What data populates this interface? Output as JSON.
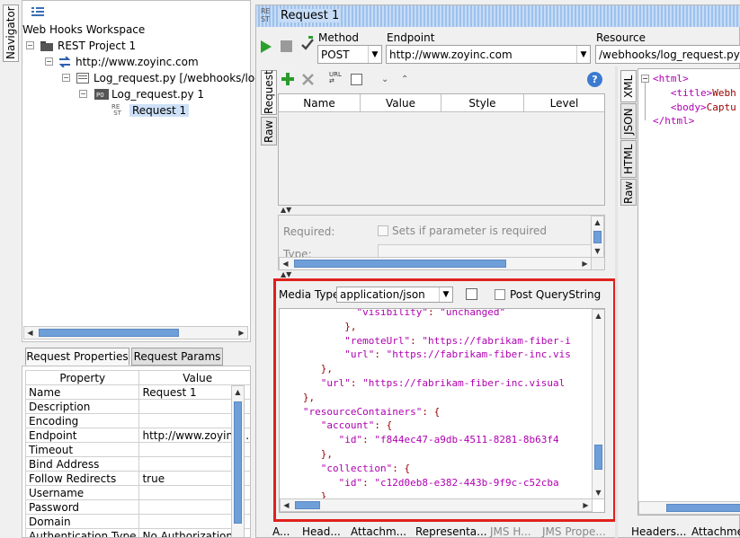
{
  "navigator": {
    "tab_label": "Navigator"
  },
  "tree": {
    "workspace": "Web Hooks Workspace",
    "project": "REST Project 1",
    "endpoint": "http://www.zoyinc.com",
    "resource": "Log_request.py [/webhooks/log_",
    "method": "Log_request.py 1",
    "request": "Request 1"
  },
  "props_tabs": {
    "request_properties": "Request Properties",
    "request_params": "Request Params"
  },
  "props_table": {
    "headers": [
      "Property",
      "Value"
    ],
    "rows": [
      [
        "Name",
        "Request 1"
      ],
      [
        "Description",
        ""
      ],
      [
        "Encoding",
        ""
      ],
      [
        "Endpoint",
        "http://www.zoyinc...."
      ],
      [
        "Timeout",
        ""
      ],
      [
        "Bind Address",
        ""
      ],
      [
        "Follow Redirects",
        "true"
      ],
      [
        "Username",
        ""
      ],
      [
        "Password",
        ""
      ],
      [
        "Domain",
        ""
      ],
      [
        "Authentication Type",
        "No Authorization"
      ]
    ]
  },
  "request": {
    "title": "Request 1",
    "rest_icon": "RE ST",
    "method_label": "Method",
    "method_value": "POST",
    "endpoint_label": "Endpoint",
    "endpoint_value": "http://www.zoyinc.com",
    "resource_label": "Resource",
    "resource_value": "/webhooks/log_request.py"
  },
  "left_vtabs": {
    "request": "Request",
    "raw": "Raw"
  },
  "params_table": {
    "headers": [
      "Name",
      "Value",
      "Style",
      "Level"
    ]
  },
  "param_detail": {
    "required_label": "Required:",
    "required_checkbox": "Sets if parameter is required",
    "type_label": "Type:"
  },
  "media": {
    "label": "Media Type",
    "value": "application/json",
    "post_query": "Post QueryString"
  },
  "body_code": [
    {
      "indent": "            ",
      "t": [
        [
          "k",
          "\"visibility\""
        ],
        [
          "p",
          ": "
        ],
        [
          "s",
          "\"unchanged\""
        ]
      ]
    },
    {
      "indent": "          ",
      "t": [
        [
          "p",
          "},"
        ]
      ]
    },
    {
      "indent": "          ",
      "t": [
        [
          "k",
          "\"remoteUrl\""
        ],
        [
          "p",
          ": "
        ],
        [
          "s",
          "\"https://fabrikam-fiber-i"
        ]
      ]
    },
    {
      "indent": "          ",
      "t": [
        [
          "k",
          "\"url\""
        ],
        [
          "p",
          ": "
        ],
        [
          "s",
          "\"https://fabrikam-fiber-inc.vis"
        ]
      ]
    },
    {
      "indent": "      ",
      "t": [
        [
          "p",
          "},"
        ]
      ]
    },
    {
      "indent": "      ",
      "t": [
        [
          "k",
          "\"url\""
        ],
        [
          "p",
          ": "
        ],
        [
          "s",
          "\"https://fabrikam-fiber-inc.visual"
        ]
      ]
    },
    {
      "indent": "   ",
      "t": [
        [
          "p",
          "},"
        ]
      ]
    },
    {
      "indent": "   ",
      "t": [
        [
          "k",
          "\"resourceContainers\""
        ],
        [
          "p",
          ": {"
        ]
      ]
    },
    {
      "indent": "      ",
      "t": [
        [
          "k",
          "\"account\""
        ],
        [
          "p",
          ": {"
        ]
      ]
    },
    {
      "indent": "         ",
      "t": [
        [
          "k",
          "\"id\""
        ],
        [
          "p",
          ": "
        ],
        [
          "s",
          "\"f844ec47-a9db-4511-8281-8b63f4"
        ]
      ]
    },
    {
      "indent": "      ",
      "t": [
        [
          "p",
          "},"
        ]
      ]
    },
    {
      "indent": "      ",
      "t": [
        [
          "k",
          "\"collection\""
        ],
        [
          "p",
          ": {"
        ]
      ]
    },
    {
      "indent": "         ",
      "t": [
        [
          "k",
          "\"id\""
        ],
        [
          "p",
          ": "
        ],
        [
          "s",
          "\"c12d0eb8-e382-443b-9f9c-c52cba"
        ]
      ]
    },
    {
      "indent": "      ",
      "t": [
        [
          "p",
          "}"
        ]
      ]
    }
  ],
  "bottom_tabs": [
    "A...",
    "Head...",
    "Attachm...",
    "Representa...",
    "JMS H...",
    "JMS Prope..."
  ],
  "right_vtabs": {
    "xml": "XML",
    "json": "JSON",
    "html": "HTML",
    "raw": "Raw"
  },
  "response_code": [
    {
      "indent": "",
      "t": [
        [
          "tag",
          "<html>"
        ]
      ]
    },
    {
      "indent": "   ",
      "t": [
        [
          "tag",
          "<title>"
        ],
        [
          "p",
          "Webh"
        ]
      ]
    },
    {
      "indent": "   ",
      "t": [
        [
          "tag",
          "<body>"
        ],
        [
          "p",
          "Captu"
        ]
      ]
    },
    {
      "indent": "",
      "t": [
        [
          "tag",
          "</html>"
        ]
      ]
    }
  ],
  "response_bottom_tabs": [
    "Headers...",
    "Attachme"
  ],
  "colors": {
    "highlight": "#e0201c",
    "accent": "#6f9fd8",
    "selected": "#cde0f7",
    "play": "#2ca02c",
    "add": "#2a9a2a"
  }
}
